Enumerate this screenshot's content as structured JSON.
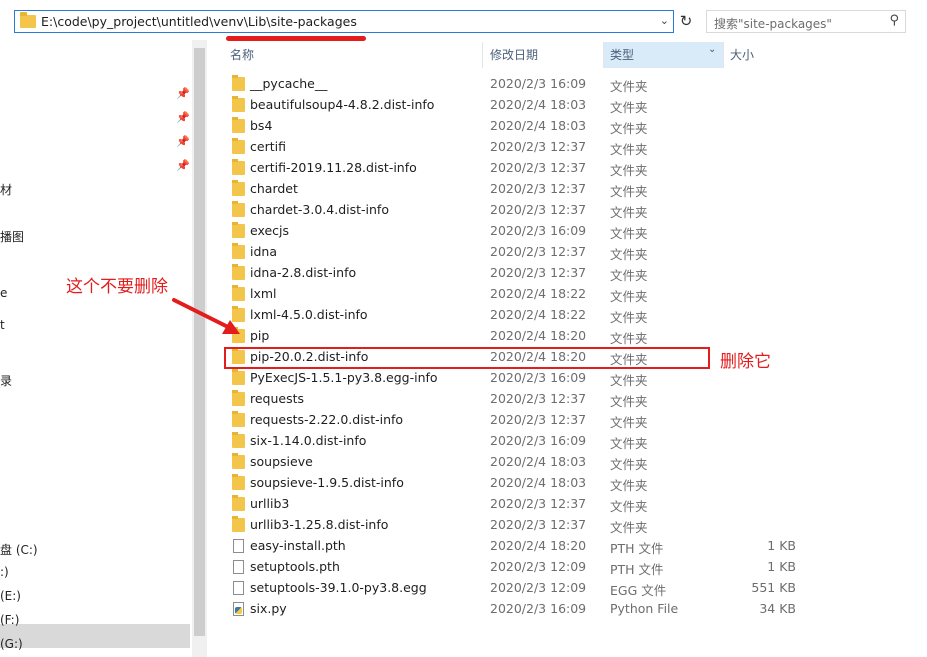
{
  "address": {
    "path": "E:\\code\\py_project\\untitled\\venv\\Lib\\site-packages"
  },
  "search": {
    "placeholder": "搜索\"site-packages\""
  },
  "columns": {
    "name": "名称",
    "date": "修改日期",
    "type": "类型",
    "size": "大小"
  },
  "nav": {
    "items": [
      "材",
      "播图",
      "e",
      "t",
      "录",
      "盘 (C:)",
      ":)",
      "(E:)",
      "(F:)",
      "(G:)"
    ]
  },
  "rows": [
    {
      "name": "__pycache__",
      "date": "2020/2/3 16:09",
      "type": "文件夹",
      "size": "",
      "icon": "folder"
    },
    {
      "name": "beautifulsoup4-4.8.2.dist-info",
      "date": "2020/2/4 18:03",
      "type": "文件夹",
      "size": "",
      "icon": "folder"
    },
    {
      "name": "bs4",
      "date": "2020/2/4 18:03",
      "type": "文件夹",
      "size": "",
      "icon": "folder"
    },
    {
      "name": "certifi",
      "date": "2020/2/3 12:37",
      "type": "文件夹",
      "size": "",
      "icon": "folder"
    },
    {
      "name": "certifi-2019.11.28.dist-info",
      "date": "2020/2/3 12:37",
      "type": "文件夹",
      "size": "",
      "icon": "folder"
    },
    {
      "name": "chardet",
      "date": "2020/2/3 12:37",
      "type": "文件夹",
      "size": "",
      "icon": "folder"
    },
    {
      "name": "chardet-3.0.4.dist-info",
      "date": "2020/2/3 12:37",
      "type": "文件夹",
      "size": "",
      "icon": "folder"
    },
    {
      "name": "execjs",
      "date": "2020/2/3 16:09",
      "type": "文件夹",
      "size": "",
      "icon": "folder"
    },
    {
      "name": "idna",
      "date": "2020/2/3 12:37",
      "type": "文件夹",
      "size": "",
      "icon": "folder"
    },
    {
      "name": "idna-2.8.dist-info",
      "date": "2020/2/3 12:37",
      "type": "文件夹",
      "size": "",
      "icon": "folder"
    },
    {
      "name": "lxml",
      "date": "2020/2/4 18:22",
      "type": "文件夹",
      "size": "",
      "icon": "folder"
    },
    {
      "name": "lxml-4.5.0.dist-info",
      "date": "2020/2/4 18:22",
      "type": "文件夹",
      "size": "",
      "icon": "folder"
    },
    {
      "name": "pip",
      "date": "2020/2/4 18:20",
      "type": "文件夹",
      "size": "",
      "icon": "folder"
    },
    {
      "name": "pip-20.0.2.dist-info",
      "date": "2020/2/4 18:20",
      "type": "文件夹",
      "size": "",
      "icon": "folder"
    },
    {
      "name": "PyExecJS-1.5.1-py3.8.egg-info",
      "date": "2020/2/3 16:09",
      "type": "文件夹",
      "size": "",
      "icon": "folder"
    },
    {
      "name": "requests",
      "date": "2020/2/3 12:37",
      "type": "文件夹",
      "size": "",
      "icon": "folder"
    },
    {
      "name": "requests-2.22.0.dist-info",
      "date": "2020/2/3 12:37",
      "type": "文件夹",
      "size": "",
      "icon": "folder"
    },
    {
      "name": "six-1.14.0.dist-info",
      "date": "2020/2/3 16:09",
      "type": "文件夹",
      "size": "",
      "icon": "folder"
    },
    {
      "name": "soupsieve",
      "date": "2020/2/4 18:03",
      "type": "文件夹",
      "size": "",
      "icon": "folder"
    },
    {
      "name": "soupsieve-1.9.5.dist-info",
      "date": "2020/2/4 18:03",
      "type": "文件夹",
      "size": "",
      "icon": "folder"
    },
    {
      "name": "urllib3",
      "date": "2020/2/3 12:37",
      "type": "文件夹",
      "size": "",
      "icon": "folder"
    },
    {
      "name": "urllib3-1.25.8.dist-info",
      "date": "2020/2/3 12:37",
      "type": "文件夹",
      "size": "",
      "icon": "folder"
    },
    {
      "name": "easy-install.pth",
      "date": "2020/2/4 18:20",
      "type": "PTH 文件",
      "size": "1 KB",
      "icon": "file"
    },
    {
      "name": "setuptools.pth",
      "date": "2020/2/3 12:09",
      "type": "PTH 文件",
      "size": "1 KB",
      "icon": "file"
    },
    {
      "name": "setuptools-39.1.0-py3.8.egg",
      "date": "2020/2/3 12:09",
      "type": "EGG 文件",
      "size": "551 KB",
      "icon": "file"
    },
    {
      "name": "six.py",
      "date": "2020/2/3 16:09",
      "type": "Python File",
      "size": "34 KB",
      "icon": "py"
    }
  ],
  "annotations": {
    "keep": "这个不要删除",
    "delete": "删除它"
  },
  "colors": {
    "accent": "#2a7bd8",
    "annotation": "#e31c1c",
    "folder": "#f3c54a"
  }
}
